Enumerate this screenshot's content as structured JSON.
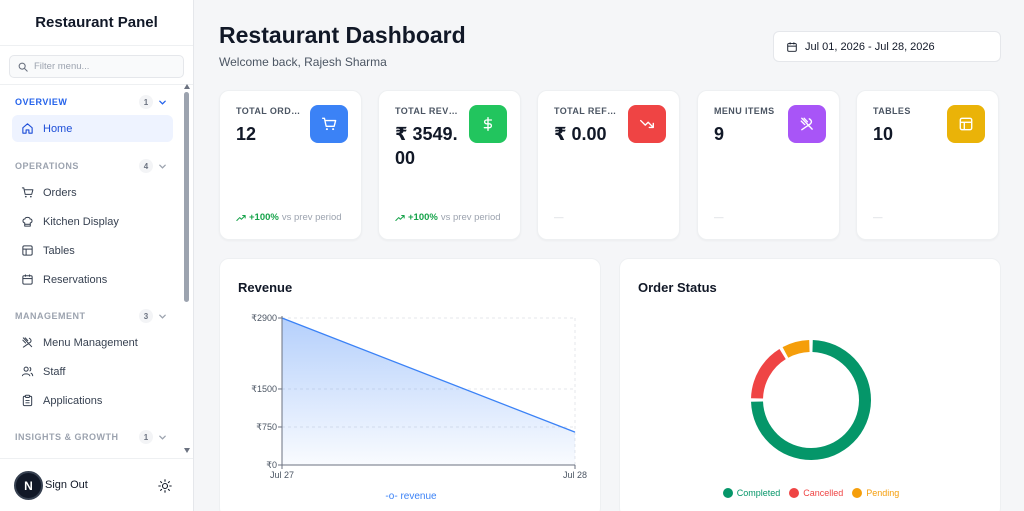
{
  "sidebar": {
    "title": "Restaurant Panel",
    "search_placeholder": "Filter menu...",
    "sections": [
      {
        "label": "OVERVIEW",
        "count": "1"
      },
      {
        "label": "OPERATIONS",
        "count": "4"
      },
      {
        "label": "MANAGEMENT",
        "count": "3"
      },
      {
        "label": "INSIGHTS & GROWTH",
        "count": "1"
      }
    ],
    "items": [
      {
        "label": "Home",
        "icon": "home-icon"
      },
      {
        "label": "Orders",
        "icon": "cart-icon"
      },
      {
        "label": "Kitchen Display",
        "icon": "chef-hat-icon"
      },
      {
        "label": "Tables",
        "icon": "table-icon"
      },
      {
        "label": "Reservations",
        "icon": "calendar-icon"
      },
      {
        "label": "Menu Management",
        "icon": "utensils-icon"
      },
      {
        "label": "Staff",
        "icon": "users-icon"
      },
      {
        "label": "Applications",
        "icon": "clipboard-icon"
      }
    ],
    "footer": {
      "avatar_letter": "N",
      "sign_out": "Sign Out"
    }
  },
  "header": {
    "title": "Restaurant Dashboard",
    "subtitle": "Welcome back, Rajesh Sharma",
    "date_range": "Jul 01, 2026 - Jul 28, 2026"
  },
  "stats": [
    {
      "label": "TOTAL ORDERS",
      "value": "12",
      "trend_pct": "+100%",
      "trend_text": "vs prev period",
      "icon": "cart-icon",
      "color": "#3b82f6"
    },
    {
      "label": "TOTAL REVENUE",
      "value": "₹ 3549.00",
      "trend_pct": "+100%",
      "trend_text": "vs prev period",
      "icon": "dollar-icon",
      "color": "#22c55e"
    },
    {
      "label": "TOTAL REFUNDS",
      "value": "₹ 0.00",
      "trend_pct": "",
      "trend_text": "—",
      "icon": "trending-down-icon",
      "color": "#ef4444"
    },
    {
      "label": "MENU ITEMS",
      "value": "9",
      "trend_pct": "",
      "trend_text": "—",
      "icon": "utensils-icon",
      "color": "#a855f7"
    },
    {
      "label": "TABLES",
      "value": "10",
      "trend_pct": "",
      "trend_text": "—",
      "icon": "table-icon",
      "color": "#eab308"
    }
  ],
  "chart_data": [
    {
      "type": "area",
      "title": "Revenue",
      "x": [
        "Jul 27",
        "Jul 28"
      ],
      "series": [
        {
          "name": "revenue",
          "values": [
            2900,
            649
          ]
        }
      ],
      "yticks": [
        "₹2900",
        "₹1500",
        "₹750",
        "₹0"
      ],
      "ytick_values": [
        2900,
        1500,
        750,
        0
      ],
      "ylim": [
        0,
        2900
      ],
      "grid": true,
      "legend": "bottom",
      "color": "#3b82f6"
    },
    {
      "type": "pie",
      "title": "Order Status",
      "categories": [
        "Completed",
        "Cancelled",
        "Pending"
      ],
      "values": [
        9,
        2,
        1
      ],
      "colors": [
        "#059669",
        "#ef4444",
        "#f59e0b"
      ],
      "legend": "bottom"
    }
  ]
}
